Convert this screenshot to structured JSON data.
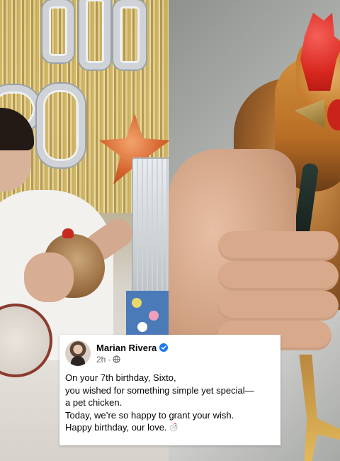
{
  "post": {
    "author": "Marian Rivera",
    "time": "2h",
    "separator": "·",
    "lines": [
      "On your 7th birthday, Sixto,",
      "you wished for something simple yet special—",
      "a pet chicken.",
      "Today, we’re so happy to grant your wish.",
      "Happy birthday, our love."
    ],
    "icons": {
      "verified": "verified-badge-icon",
      "audience": "globe-icon",
      "emoji": "chick-emoji-icon"
    },
    "colors": {
      "verified": "#1877f2",
      "meta": "#65676b",
      "text": "#050505"
    }
  }
}
